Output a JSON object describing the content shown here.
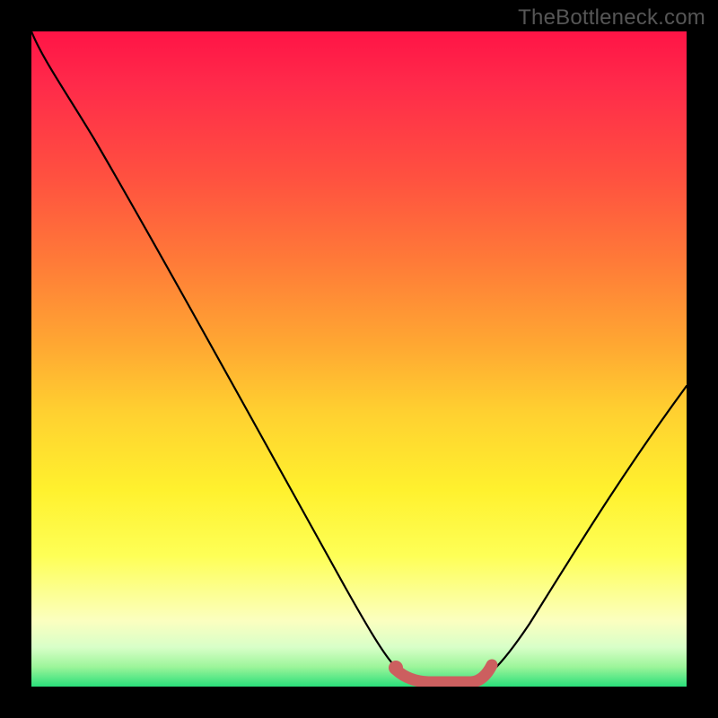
{
  "watermark": {
    "text": "TheBottleneck.com"
  },
  "chart_data": {
    "type": "line",
    "title": "",
    "xlabel": "",
    "ylabel": "",
    "xlim": [
      0,
      1
    ],
    "ylim": [
      0,
      1
    ],
    "series": [
      {
        "name": "bottleneck-curve",
        "color": "#000000",
        "x": [
          0.0,
          0.03,
          0.1,
          0.2,
          0.3,
          0.4,
          0.5,
          0.56,
          0.6,
          0.66,
          0.7,
          0.76,
          0.82,
          0.88,
          0.94,
          1.0
        ],
        "y": [
          1.0,
          0.98,
          0.86,
          0.69,
          0.52,
          0.36,
          0.19,
          0.07,
          0.02,
          0.0,
          0.0,
          0.03,
          0.1,
          0.2,
          0.32,
          0.46
        ]
      },
      {
        "name": "highlight-segment",
        "color": "#cc5f5f",
        "x": [
          0.56,
          0.58,
          0.62,
          0.66,
          0.68,
          0.7
        ],
        "y": [
          0.025,
          0.013,
          0.005,
          0.005,
          0.01,
          0.028
        ]
      }
    ],
    "points": [
      {
        "name": "highlight-start-dot",
        "x": 0.56,
        "y": 0.03,
        "color": "#cc5f5f"
      }
    ],
    "gradient_stops": [
      {
        "pos": 0.0,
        "color": "#ff1446"
      },
      {
        "pos": 0.35,
        "color": "#ff7a38"
      },
      {
        "pos": 0.7,
        "color": "#fff12e"
      },
      {
        "pos": 0.9,
        "color": "#fbffc0"
      },
      {
        "pos": 1.0,
        "color": "#2adf7a"
      }
    ]
  }
}
